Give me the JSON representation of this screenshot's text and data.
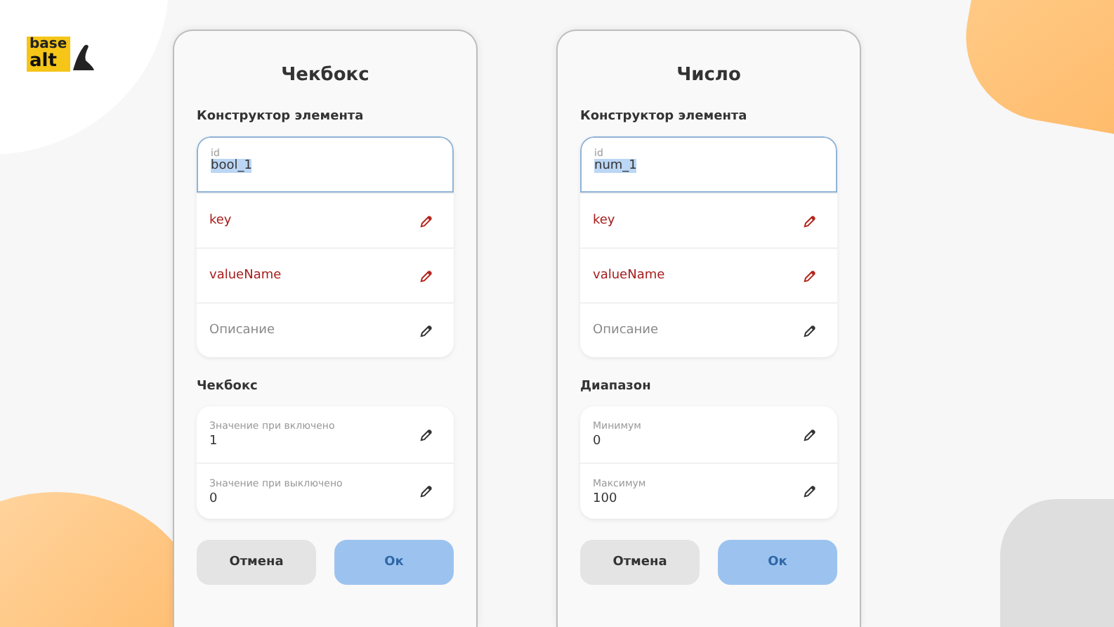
{
  "logo": {
    "top": "base",
    "bottom": "alt"
  },
  "dialogs": [
    {
      "title": "Чекбокс",
      "constructor_heading": "Конструктор элемента",
      "id_field": {
        "label": "id",
        "value": "bool_1",
        "focused": true
      },
      "fields": [
        {
          "label": "key",
          "required": true
        },
        {
          "label": "valueName",
          "required": true
        },
        {
          "label": "Описание",
          "required": false
        }
      ],
      "section_heading": "Чекбокс",
      "section_fields": [
        {
          "label": "Значение при включено",
          "value": "1"
        },
        {
          "label": "Значение при выключено",
          "value": "0"
        }
      ],
      "buttons": [
        {
          "label": "Отмена",
          "kind": "cancel",
          "disabled": false
        },
        {
          "label": "Ок",
          "kind": "primary",
          "disabled": true
        }
      ]
    },
    {
      "title": "Число",
      "constructor_heading": "Конструктор элемента",
      "id_field": {
        "label": "id",
        "value": "num_1",
        "focused": true
      },
      "fields": [
        {
          "label": "key",
          "required": true
        },
        {
          "label": "valueName",
          "required": true
        },
        {
          "label": "Описание",
          "required": false
        }
      ],
      "section_heading": "Диапазон",
      "section_fields": [
        {
          "label": "Минимум",
          "value": "0"
        },
        {
          "label": "Максимум",
          "value": "100"
        }
      ],
      "buttons": [
        {
          "label": "Отмена",
          "kind": "cancel",
          "disabled": false
        },
        {
          "label": "Ок",
          "kind": "primary",
          "disabled": true
        }
      ]
    }
  ]
}
